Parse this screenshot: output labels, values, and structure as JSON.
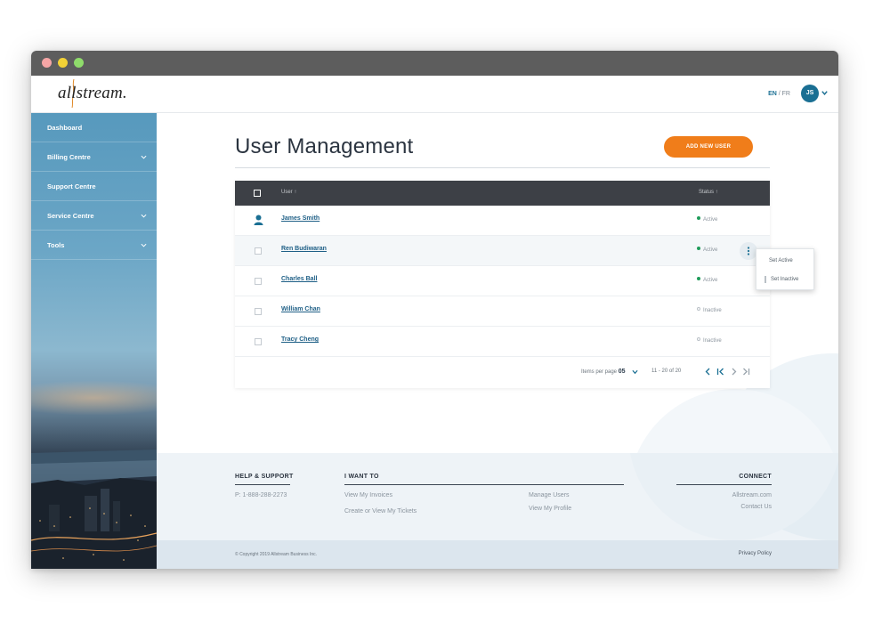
{
  "header": {
    "logo_text": "allstream.",
    "lang_en": "EN",
    "lang_sep": " / ",
    "lang_fr": "FR",
    "user_initials": "JS"
  },
  "sidebar": {
    "items": [
      {
        "label": "Dashboard",
        "has_submenu": false
      },
      {
        "label": "Billing Centre",
        "has_submenu": true
      },
      {
        "label": "Support Centre",
        "has_submenu": false
      },
      {
        "label": "Service Centre",
        "has_submenu": true
      },
      {
        "label": "Tools",
        "has_submenu": true
      }
    ]
  },
  "main": {
    "title": "User Management",
    "add_button": "ADD NEW USER",
    "table": {
      "col_user": "User",
      "col_status": "Status",
      "rows": [
        {
          "name": "James Smith",
          "status": "Active"
        },
        {
          "name": "Ren Budiwaran",
          "status": "Active"
        },
        {
          "name": "Charles Ball",
          "status": "Active"
        },
        {
          "name": "William Chan",
          "status": "Inactive"
        },
        {
          "name": "Tracy Cheng",
          "status": "Inactive"
        }
      ]
    },
    "pagination": {
      "items_per_page_label": "Items per page",
      "items_per_page_value": "05",
      "range": "11 - 20 of 20"
    },
    "status_menu": {
      "set_active": "Set Active",
      "set_inactive": "Set Inactive"
    }
  },
  "footer": {
    "help_heading": "HELP & SUPPORT",
    "phone": "P: 1-888-288-2273",
    "want_heading": "I WANT TO",
    "links_col1": [
      "View My Invoices",
      "Create or View My Tickets"
    ],
    "links_col2": [
      "Manage Users",
      "View My Profile"
    ],
    "connect_heading": "CONNECT",
    "connect_links": [
      "Allstream.com",
      "Contact Us"
    ],
    "copyright": "© Copyright 2019 Allstream Business Inc.",
    "privacy": "Privacy Policy"
  },
  "colors": {
    "accent_orange": "#f07d1a",
    "brand_blue": "#1a6f93",
    "active_green": "#1f9c5a",
    "table_header": "#3d4046"
  }
}
